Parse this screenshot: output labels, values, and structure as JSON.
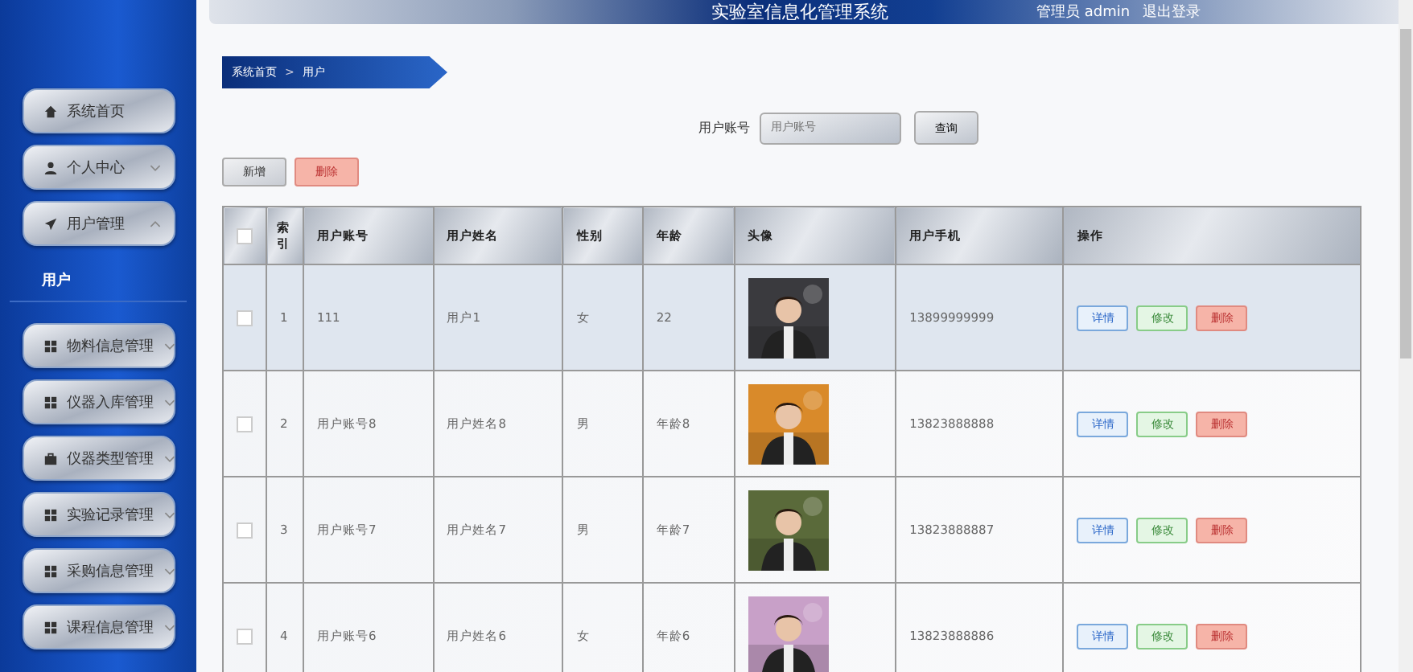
{
  "header": {
    "title": "实验室信息化管理系统",
    "user": "管理员 admin",
    "logout": "退出登录"
  },
  "sidebar": {
    "items": [
      {
        "label": "系统首页"
      },
      {
        "label": "个人中心",
        "expanded": false
      },
      {
        "label": "用户管理",
        "expanded": true,
        "children": [
          {
            "label": "用户",
            "selected": true
          }
        ]
      },
      {
        "label": "物料信息管理",
        "expanded": false
      },
      {
        "label": "仪器入库管理",
        "expanded": false
      },
      {
        "label": "仪器类型管理",
        "expanded": false
      },
      {
        "label": "实验记录管理",
        "expanded": false
      },
      {
        "label": "采购信息管理",
        "expanded": false
      },
      {
        "label": "课程信息管理",
        "expanded": false
      }
    ]
  },
  "breadcrumb": {
    "home": "系统首页",
    "separator": ">",
    "current": "用户"
  },
  "search": {
    "label": "用户账号",
    "placeholder": "用户账号",
    "button": "查询"
  },
  "actions": [
    "新增",
    "删除"
  ],
  "table": {
    "all_checked": false,
    "columns": [
      "索引",
      "用户账号",
      "用户姓名",
      "性别",
      "年龄",
      "头像",
      "用户手机",
      "操作"
    ],
    "rows": [
      {
        "checked": false,
        "cells": [
          "1",
          "111",
          "用户1",
          "女",
          "22"
        ],
        "avatar": {
          "kind": "picture"
        },
        "phone": "13899999999",
        "buttons": [
          "详情",
          "修改",
          "删除"
        ]
      },
      {
        "checked": false,
        "cells": [
          "2",
          "用户账号8",
          "用户姓名8",
          "男",
          "年龄8"
        ],
        "avatar": {
          "kind": "picture"
        },
        "phone": "13823888888",
        "buttons": [
          "详情",
          "修改",
          "删除"
        ]
      },
      {
        "checked": false,
        "cells": [
          "3",
          "用户账号7",
          "用户姓名7",
          "男",
          "年龄7"
        ],
        "avatar": {
          "kind": "picture"
        },
        "phone": "13823888887",
        "buttons": [
          "详情",
          "修改",
          "删除"
        ]
      },
      {
        "checked": false,
        "cells": [
          "4",
          "用户账号6",
          "用户姓名6",
          "女",
          "年龄6"
        ],
        "avatar": {
          "kind": "picture"
        },
        "phone": "13823888886",
        "buttons": [
          "详情",
          "修改",
          "删除"
        ]
      }
    ]
  }
}
